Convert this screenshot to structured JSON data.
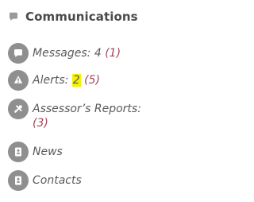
{
  "header": {
    "title": "Communications",
    "icon": "speech-bubble-icon"
  },
  "menu": {
    "items": [
      {
        "icon": "message-icon",
        "label": "Messages:",
        "count": "4",
        "sub": "(1)"
      },
      {
        "icon": "alert-icon",
        "label": "Alerts:",
        "count": "2",
        "sub": "(5)"
      },
      {
        "icon": "tools-icon",
        "label": "Assessor’s Reports:",
        "sub": "(3)"
      },
      {
        "icon": "contact-card-icon",
        "label": "News"
      },
      {
        "icon": "contact-card-icon",
        "label": "Contacts"
      }
    ]
  },
  "colors": {
    "icon_bg": "#8f8f8f",
    "text": "#5a5a5a",
    "accent": "#a0455b",
    "highlight": "#f4f200",
    "title": "#4a4a4a"
  }
}
